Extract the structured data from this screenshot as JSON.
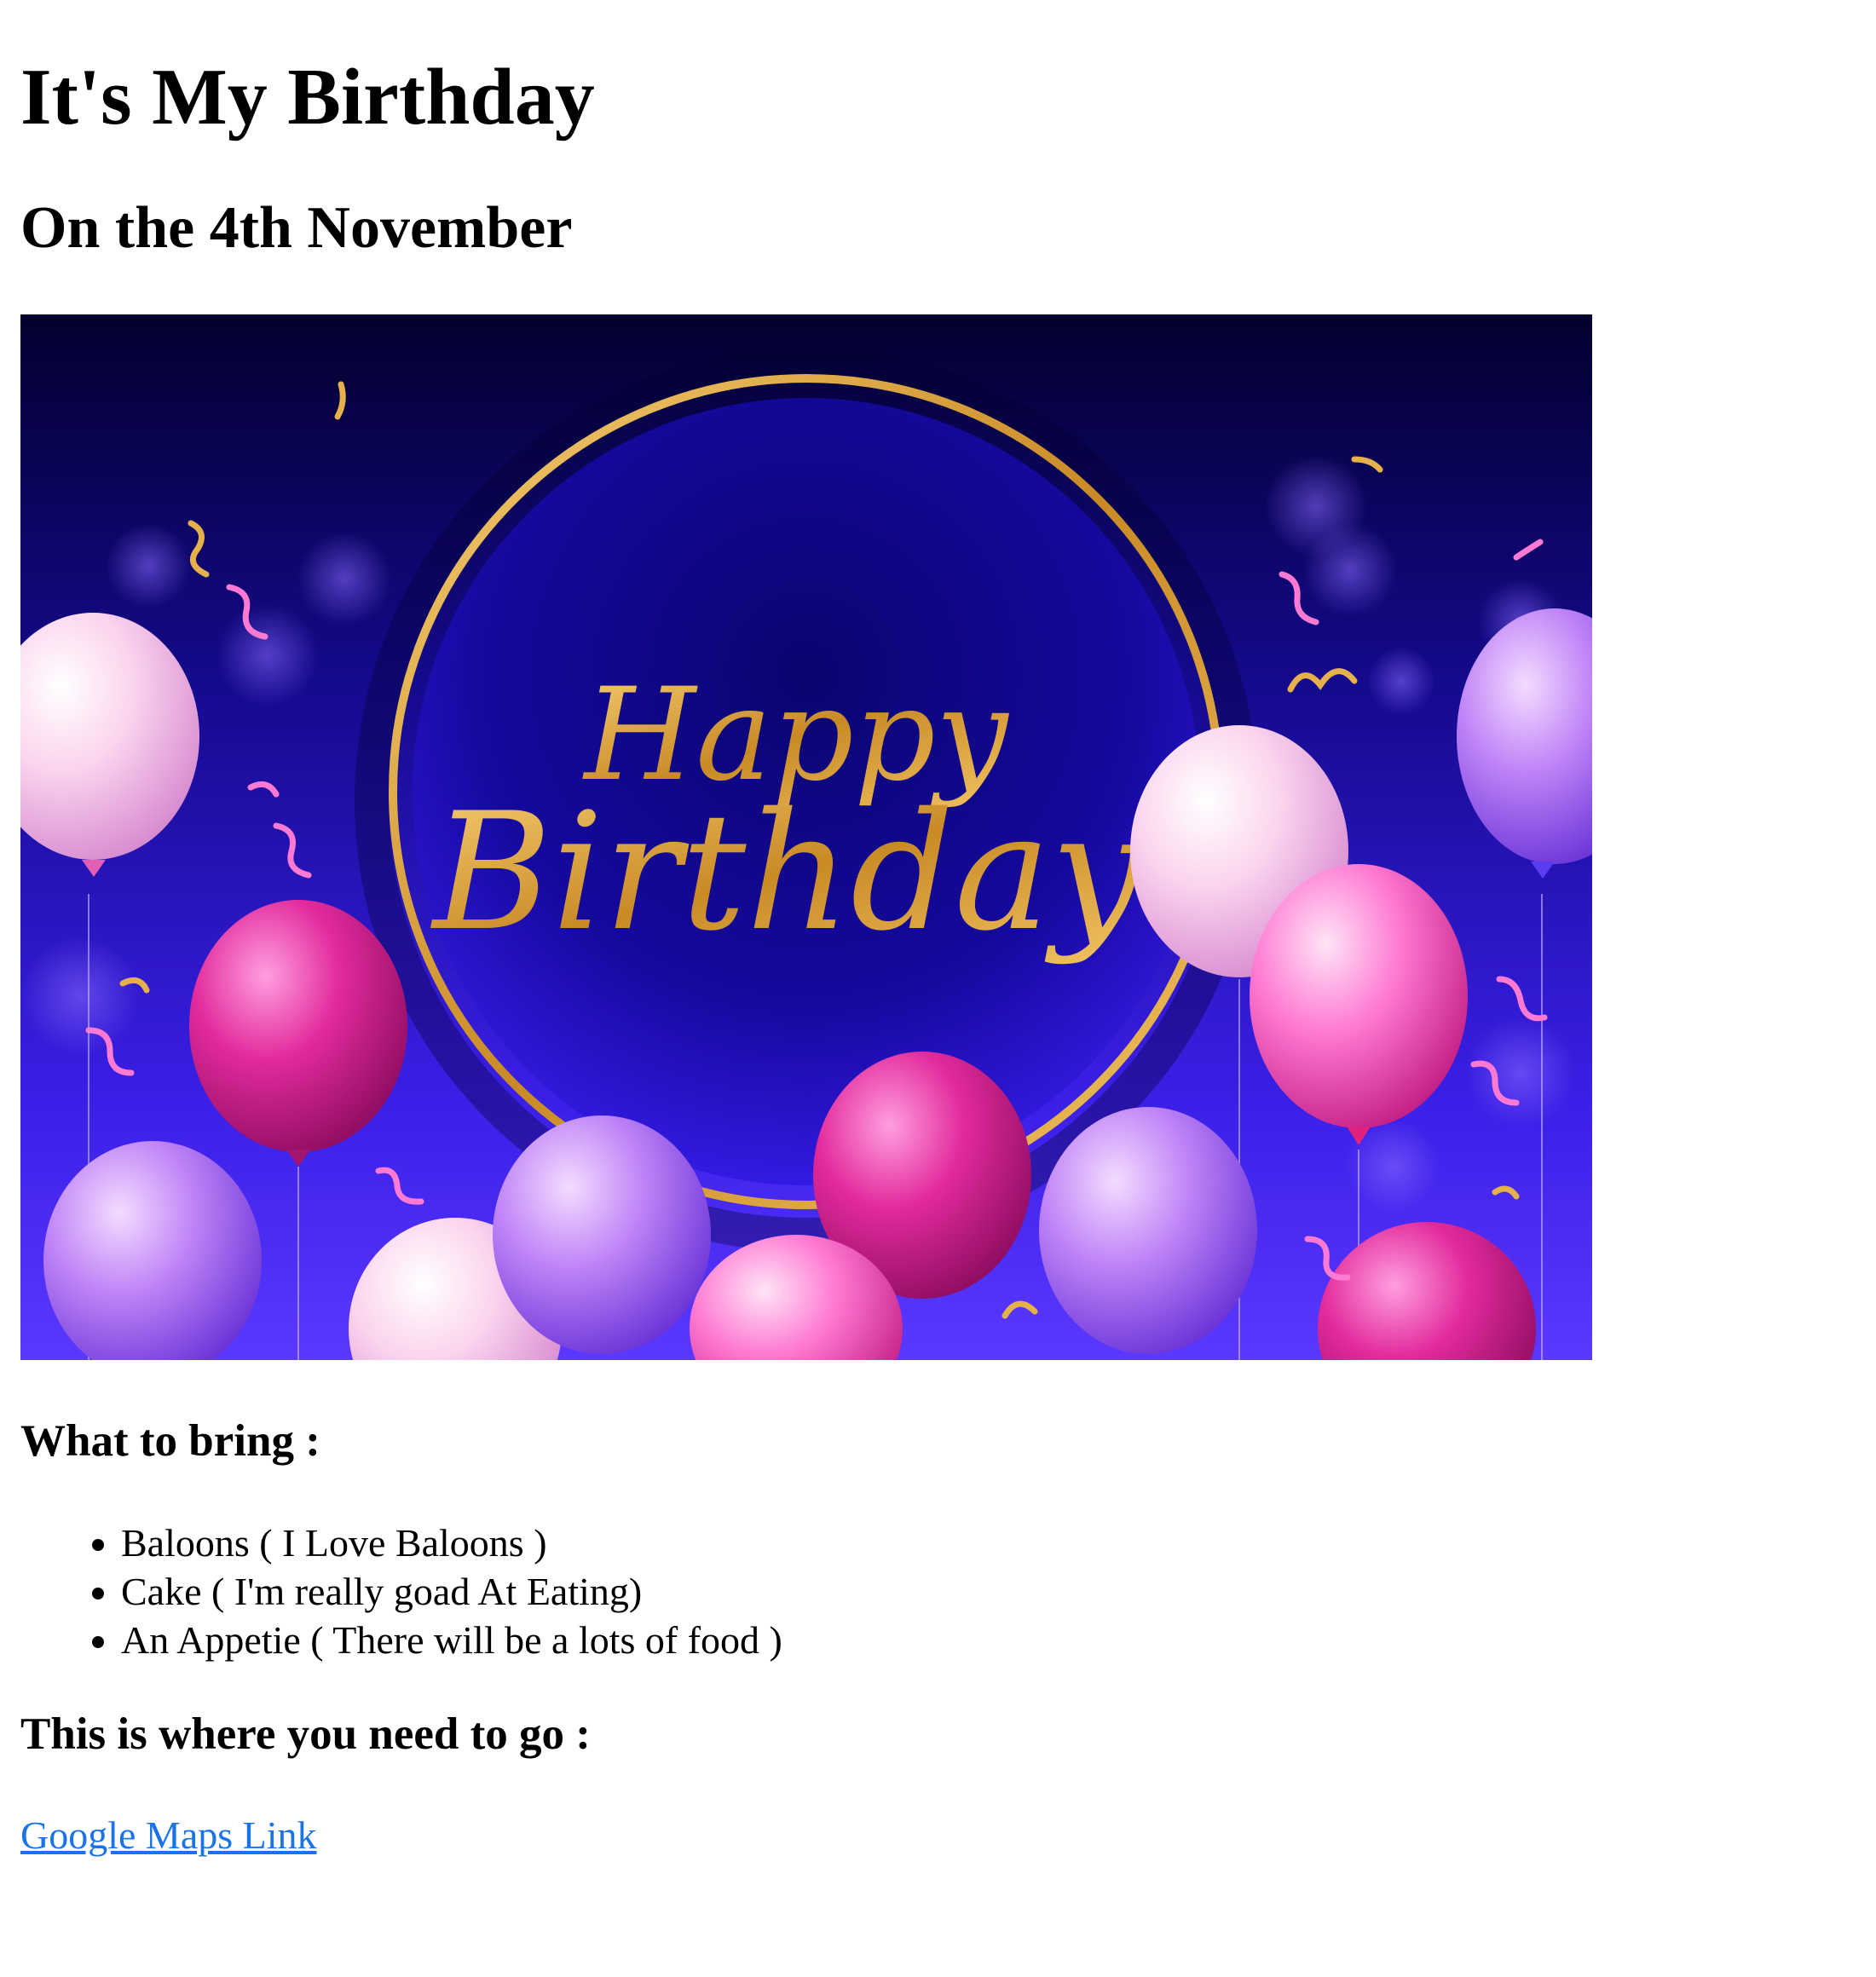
{
  "title": "It's My Birthday",
  "subtitle": "On the 4th November",
  "banner": {
    "line1": "Happy",
    "line2": "Birthday",
    "colors": {
      "background_top": "#03002e",
      "background_bottom": "#4a2bff",
      "ring": "#d69a2e",
      "script_text": "#e6b04a",
      "balloon_pink": "#ff5fc8",
      "balloon_magenta": "#e22a9c",
      "balloon_lilac": "#b67cf5",
      "balloon_light": "#fbd4ee"
    }
  },
  "bring": {
    "heading": "What to bring :",
    "items": [
      "Baloons ( I Love Baloons )",
      "Cake ( I'm really goad At Eating)",
      "An Appetie ( There will be a lots of food )"
    ]
  },
  "location": {
    "heading": "This is where you need to go :",
    "link_label": "Google Maps Link"
  },
  "colors": {
    "link": "#1a73e8",
    "text": "#000000",
    "page_background": "#ffffff"
  }
}
